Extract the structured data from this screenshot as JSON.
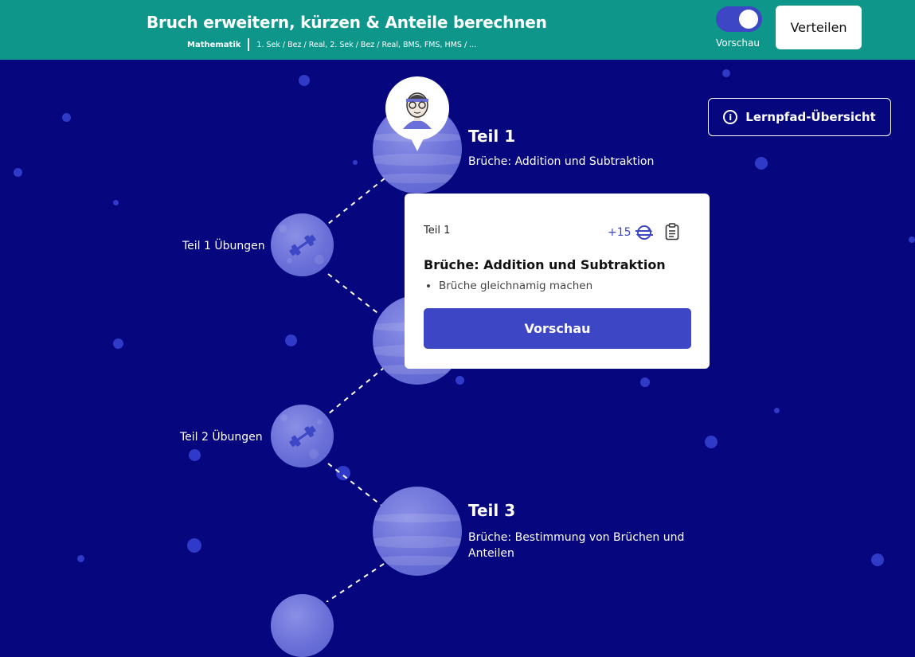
{
  "header": {
    "title": "Bruch erweitern, kürzen & Anteile berechnen",
    "subject": "Mathematik",
    "levels": "1. Sek / Bez / Real, 2. Sek / Bez / Real, BMS, FMS, HMS / ...",
    "preview_toggle_label": "Vorschau",
    "preview_toggle_on": true,
    "share_label": "Verteilen"
  },
  "overview_button_label": "Lernpfad-Übersicht",
  "path": {
    "parts": [
      {
        "title": "Teil 1",
        "subtitle": "Brüche: Addition und Subtraktion"
      },
      {
        "title": "Teil 3",
        "subtitle": "Brüche: Bestimmung von Brüchen und Anteilen"
      }
    ],
    "exercises": [
      {
        "label": "Teil 1 Übungen"
      },
      {
        "label": "Teil 2 Übungen"
      }
    ]
  },
  "popup": {
    "part_label": "Teil 1",
    "points": "+15",
    "title": "Brüche: Addition und Subtraktion",
    "bullets": [
      "Brüche gleichnamig machen"
    ],
    "button_label": "Vorschau"
  },
  "colors": {
    "background": "#06067f",
    "header": "#0e968a",
    "accent": "#3d46c4",
    "planet": "#6a70d8"
  },
  "icons": {
    "overview": "info-icon",
    "exercise": "dumbbell-icon",
    "points": "coin-swap-icon",
    "notes": "clipboard-icon"
  }
}
